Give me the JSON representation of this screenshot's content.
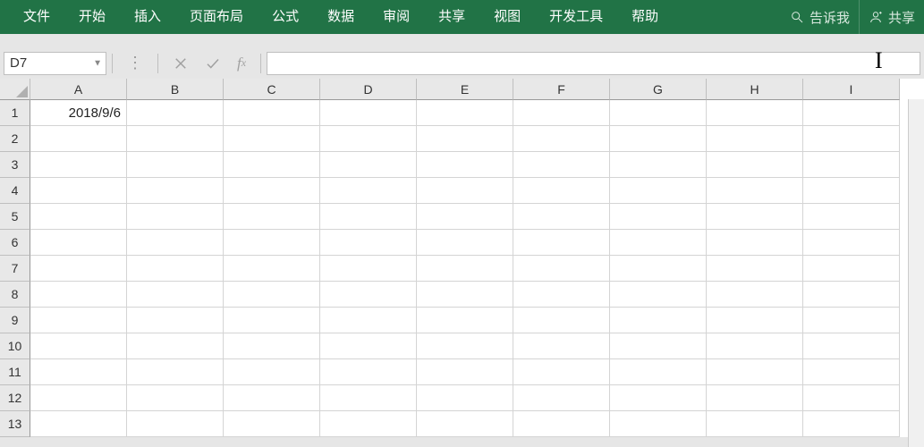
{
  "ribbon": {
    "tabs": [
      "文件",
      "开始",
      "插入",
      "页面布局",
      "公式",
      "数据",
      "审阅",
      "共享",
      "视图",
      "开发工具",
      "帮助"
    ],
    "tell_me": "告诉我",
    "share": "共享"
  },
  "formula_bar": {
    "name_box": "D7",
    "formula_value": ""
  },
  "columns": [
    "A",
    "B",
    "C",
    "D",
    "E",
    "F",
    "G",
    "H",
    "I"
  ],
  "rows": [
    1,
    2,
    3,
    4,
    5,
    6,
    7,
    8,
    9,
    10,
    11,
    12,
    13
  ],
  "cells": {
    "A1": "2018/9/6"
  }
}
